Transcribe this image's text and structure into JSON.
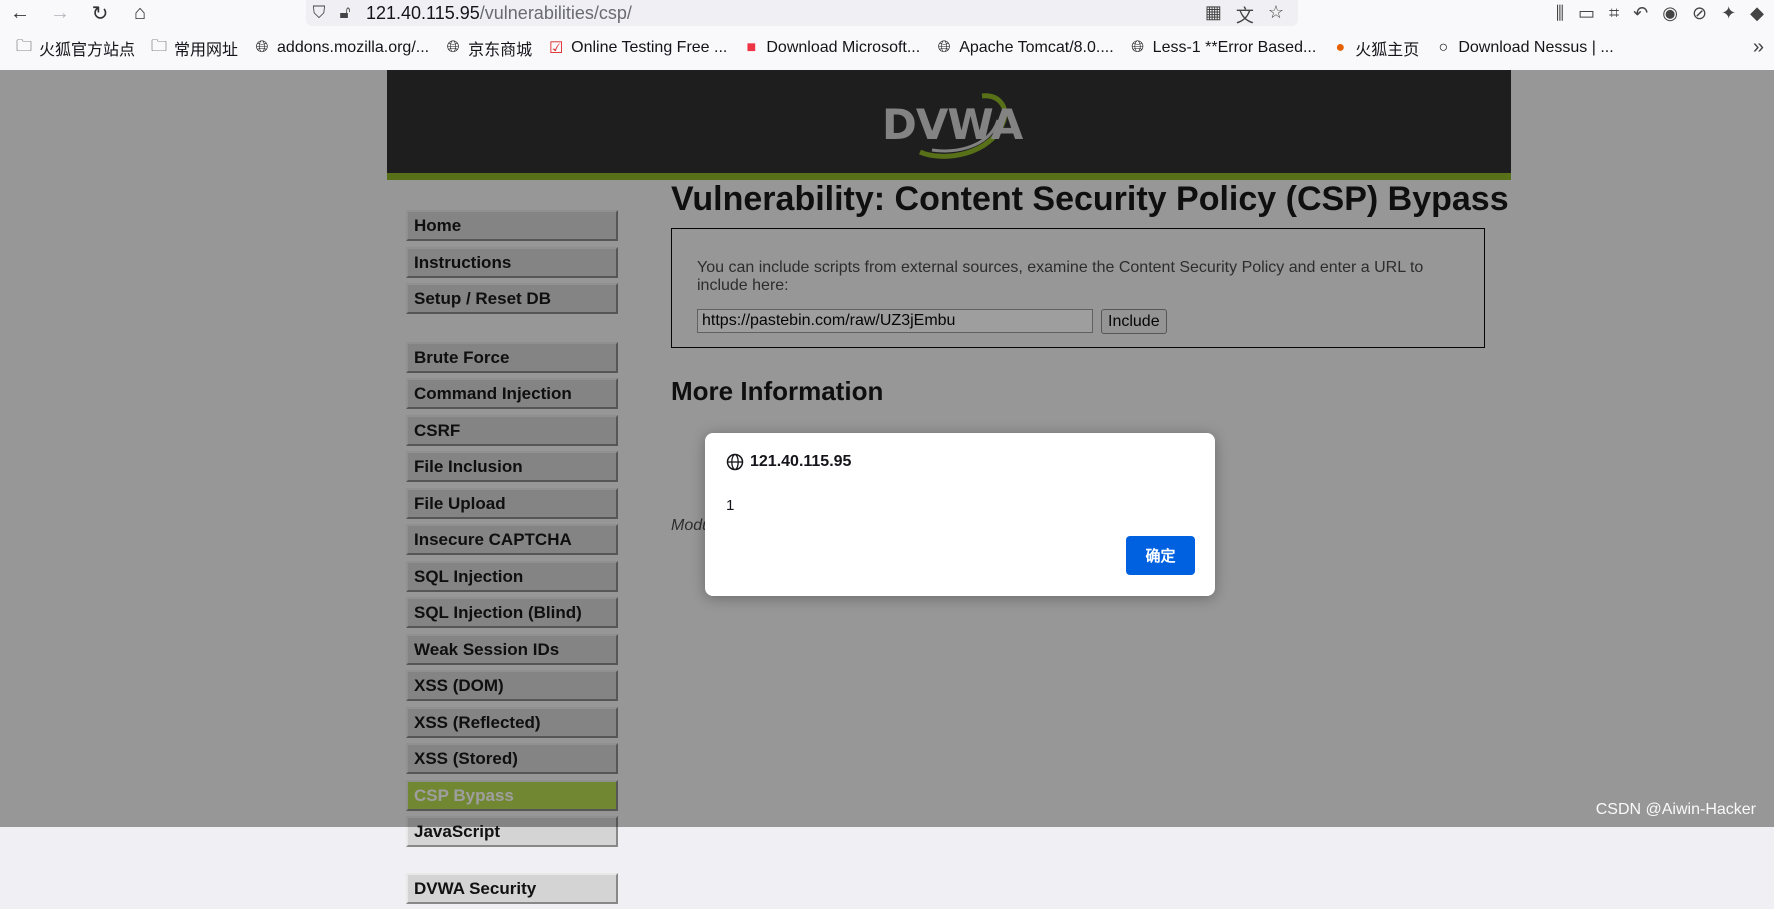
{
  "browser": {
    "url_host": "121.40.115.95",
    "url_path": "/vulnerabilities/csp/",
    "bookmarks": [
      {
        "label": "火狐官方站点",
        "icon": "folder-icon"
      },
      {
        "label": "常用网址",
        "icon": "folder-icon"
      },
      {
        "label": "addons.mozilla.org/...",
        "icon": "globe-icon"
      },
      {
        "label": "京东商城",
        "icon": "globe-icon"
      },
      {
        "label": "Online Testing Free ...",
        "icon": "checkbox-icon"
      },
      {
        "label": "Download Microsoft...",
        "icon": "windows-icon"
      },
      {
        "label": "Apache Tomcat/8.0....",
        "icon": "globe-icon"
      },
      {
        "label": "Less-1 **Error Based...",
        "icon": "globe-icon"
      },
      {
        "label": "火狐主页",
        "icon": "firefox-icon"
      },
      {
        "label": "Download Nessus | ...",
        "icon": "nessus-icon"
      }
    ]
  },
  "logo": {
    "text": "DVWA"
  },
  "menu": {
    "items": [
      {
        "label": "Home"
      },
      {
        "label": "Instructions"
      },
      {
        "label": "Setup / Reset DB"
      },
      {
        "label": "Brute Force"
      },
      {
        "label": "Command Injection"
      },
      {
        "label": "CSRF"
      },
      {
        "label": "File Inclusion"
      },
      {
        "label": "File Upload"
      },
      {
        "label": "Insecure CAPTCHA"
      },
      {
        "label": "SQL Injection"
      },
      {
        "label": "SQL Injection (Blind)"
      },
      {
        "label": "Weak Session IDs"
      },
      {
        "label": "XSS (DOM)"
      },
      {
        "label": "XSS (Reflected)"
      },
      {
        "label": "XSS (Stored)"
      },
      {
        "label": "CSP Bypass"
      },
      {
        "label": "JavaScript"
      },
      {
        "label": "DVWA Security"
      }
    ],
    "selected": "CSP Bypass"
  },
  "main": {
    "title": "Vulnerability: Content Security Policy (CSP) Bypass",
    "description": "You can include scripts from external sources, examine the Content Security Policy and enter a URL to include here:",
    "input_value": "https://pastebin.com/raw/UZ3jEmbu",
    "include_label": "Include",
    "more_info": "More Information",
    "module_fragment": "Modu"
  },
  "dialog": {
    "origin": "121.40.115.95",
    "message": "1",
    "ok_label": "确定"
  },
  "watermark": "CSDN @Aiwin-Hacker",
  "colors": {
    "accent": "#8bb21f",
    "selected_menu": "#b5d94a",
    "dialog_button": "#0061e0",
    "header": "#2a2a2a"
  }
}
